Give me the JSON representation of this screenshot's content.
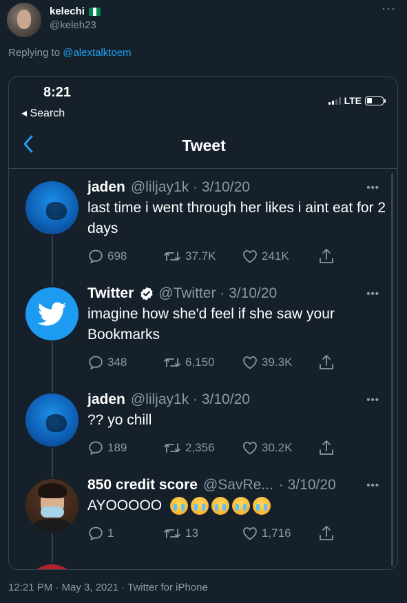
{
  "outer": {
    "name": "kelechi",
    "handle": "@keleh23",
    "more": "···",
    "replying_prefix": "Replying to",
    "replying_to": "@alextalktoem",
    "footer": "12:21 PM · May 3, 2021 · Twitter for iPhone",
    "flag_colors": [
      "#008751",
      "#ffffff",
      "#008751"
    ]
  },
  "screenshot": {
    "status_time": "8:21",
    "back_label": "◂ Search",
    "network": "LTE",
    "nav_title": "Tweet",
    "accent": "#1da1f2"
  },
  "tweets": [
    {
      "name": "jaden",
      "handle_date": "@liljay1k · 3/10/20",
      "text": "last time i went through her likes i aint eat for 2 days",
      "replies": "698",
      "retweets": "37.7K",
      "likes": "241K",
      "verified": false,
      "avatar": "jaden"
    },
    {
      "name": "Twitter",
      "handle_date": "@Twitter · 3/10/20",
      "text": "imagine how she'd feel if she saw your Bookmarks",
      "replies": "348",
      "retweets": "6,150",
      "likes": "39.3K",
      "verified": true,
      "avatar": "twitter"
    },
    {
      "name": "jaden",
      "handle_date": "@liljay1k · 3/10/20",
      "text": "?? yo chill",
      "replies": "189",
      "retweets": "2,356",
      "likes": "30.2K",
      "verified": false,
      "avatar": "jaden"
    },
    {
      "name": "850 credit score",
      "handle": "@SavRe...",
      "date": "· 3/10/20",
      "text": "AYOOOOO",
      "emoji_count": 5,
      "emoji_name": "loudly-crying-face-emoji",
      "replies": "1",
      "retweets": "13",
      "likes": "1,716",
      "verified": false,
      "avatar": "person"
    }
  ],
  "icons": {
    "reply": "reply-icon",
    "retweet": "retweet-icon",
    "like": "heart-icon",
    "share": "share-icon",
    "verified": "verified-badge-icon",
    "twitter": "twitter-bird-icon"
  }
}
